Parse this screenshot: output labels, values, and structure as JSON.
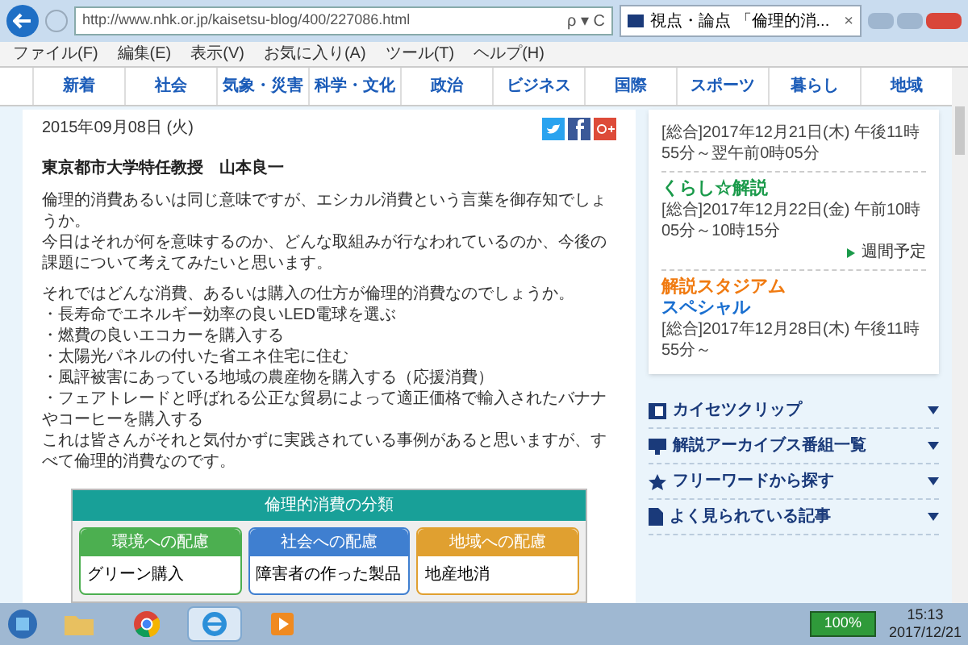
{
  "browser": {
    "url": "http://www.nhk.or.jp/kaisetsu-blog/400/227086.html",
    "search_hint": "ρ ▾ C",
    "tab": {
      "title": "視点・論点 「倫理的消...",
      "close": "×"
    }
  },
  "menu": [
    "ファイル(F)",
    "編集(E)",
    "表示(V)",
    "お気に入り(A)",
    "ツール(T)",
    "ヘルプ(H)"
  ],
  "nav": [
    "新着",
    "社会",
    "気象・災害",
    "科学・文化",
    "政治",
    "ビジネス",
    "国際",
    "スポーツ",
    "暮らし",
    "地域"
  ],
  "article": {
    "date": "2015年09月08日 (火)",
    "author": "東京都市大学特任教授　山本良一",
    "paragraphs": [
      {
        "kind": "text",
        "lines": [
          "倫理的消費あるいは同じ意味ですが、エシカル消費という言葉を御存知でしょうか。",
          "今日はそれが何を意味するのか、どんな取組みが行なわれているのか、今後の課題について考えてみたいと思います。"
        ]
      },
      {
        "kind": "text",
        "lines": [
          "それではどんな消費、あるいは購入の仕方が倫理的消費なのでしょうか。",
          "・長寿命でエネルギー効率の良いLED電球を選ぶ",
          "・燃費の良いエコカーを購入する",
          "・太陽光パネルの付いた省エネ住宅に住む",
          "・風評被害にあっている地域の農産物を購入する（応援消費）",
          "・フェアトレードと呼ばれる公正な貿易によって適正価格で輸入されたバナナやコーヒーを購入する",
          "これは皆さんがそれと気付かずに実践されている事例があると思いますが、すべて倫理的消費なのです。"
        ]
      }
    ],
    "figure": {
      "title": "倫理的消費の分類",
      "columns": [
        {
          "heading": "環境への配慮",
          "item": "グリーン購入",
          "color": "#4caf50"
        },
        {
          "heading": "社会への配慮",
          "item": "障害者の作った製品",
          "color": "#3f7fd0"
        },
        {
          "heading": "地域への配慮",
          "item": "地産地消",
          "color": "#e0a030"
        }
      ]
    }
  },
  "sidebar": {
    "programs": [
      {
        "kind": "schedule",
        "lines": [
          "[総合]2017年12月21日(木) 午後11時55分～翌午前0時05分"
        ]
      },
      {
        "kind": "program",
        "title": "くらし☆解説",
        "color": "#1a9a4a",
        "lines": [
          "[総合]2017年12月22日(金) 午前10時05分～10時15分"
        ],
        "link": "週間予定"
      },
      {
        "kind": "program",
        "title": "解説スタジアム",
        "subtitle": "スペシャル",
        "color": "#f07a10",
        "lines": [
          "[総合]2017年12月28日(木) 午後11時55分～"
        ]
      }
    ],
    "menu": [
      {
        "kind": "clip",
        "label": "カイセツクリップ"
      },
      {
        "kind": "monitor",
        "label": "解説アーカイブス番組一覧"
      },
      {
        "kind": "star",
        "label": "フリーワードから探す"
      },
      {
        "kind": "doc",
        "label": "よく見られている記事"
      }
    ]
  },
  "taskbar": {
    "apps": [
      {
        "kind": "explorer",
        "selected": false
      },
      {
        "kind": "chrome",
        "selected": false
      },
      {
        "kind": "ie",
        "selected": true
      },
      {
        "kind": "media",
        "selected": false
      }
    ],
    "battery": "100%",
    "time": "15:13",
    "date": "2017/12/21"
  }
}
